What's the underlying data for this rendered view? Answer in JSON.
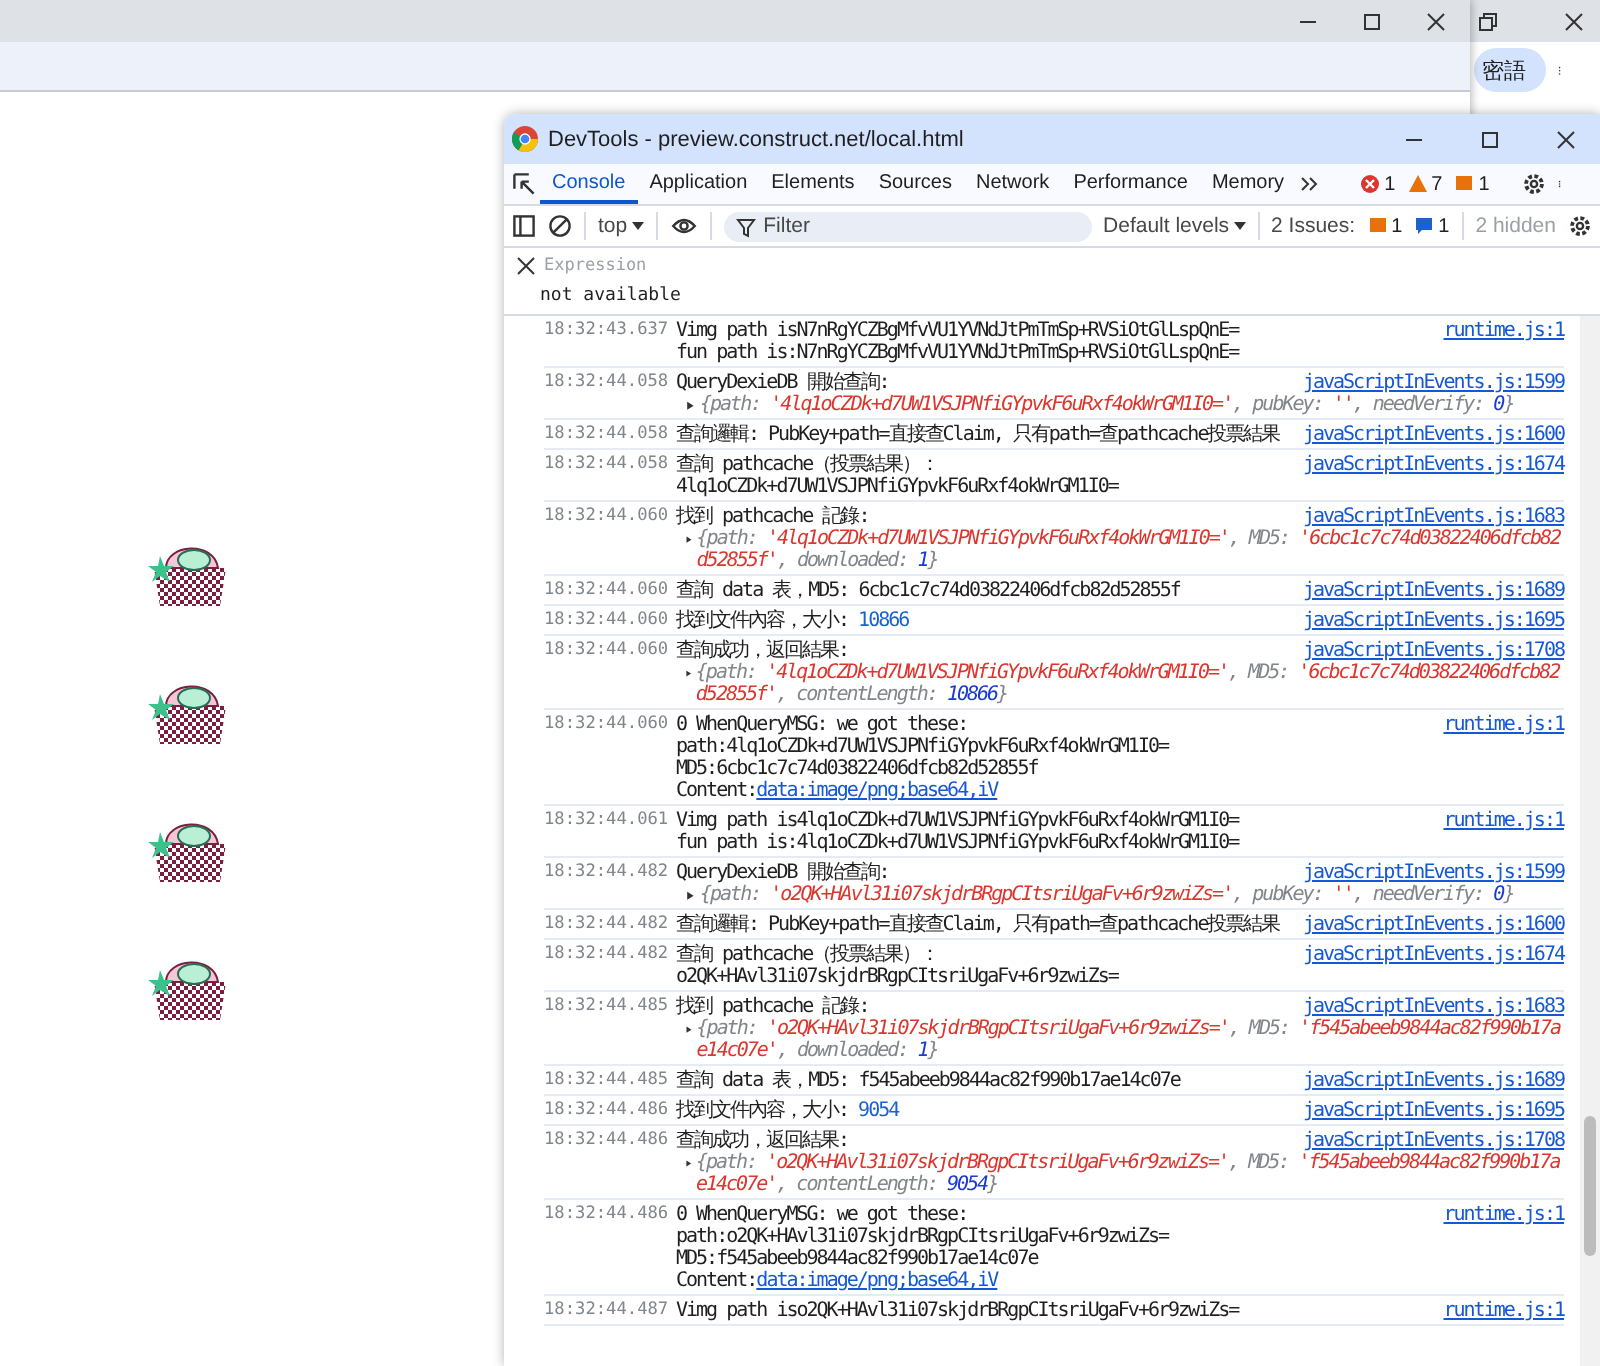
{
  "background_window": {
    "profile_button": "密語"
  },
  "devtools": {
    "title": "DevTools - preview.construct.net/local.html",
    "tabs": [
      {
        "label": "Console",
        "selected": true
      },
      {
        "label": "Application",
        "selected": false
      },
      {
        "label": "Elements",
        "selected": false
      },
      {
        "label": "Sources",
        "selected": false
      },
      {
        "label": "Network",
        "selected": false
      },
      {
        "label": "Performance",
        "selected": false
      },
      {
        "label": "Memory",
        "selected": false
      }
    ],
    "counters": {
      "errors": "1",
      "warnings": "7",
      "infos": "1"
    },
    "toolbar": {
      "context": "top",
      "filter_placeholder": "Filter",
      "levels": "Default levels",
      "issues_label": "2 Issues:",
      "issues_warning": "1",
      "issues_info": "1",
      "hidden": "2 hidden"
    },
    "expression": {
      "placeholder": "Expression",
      "value": "not available"
    },
    "logs": [
      {
        "time": "18:32:43.637",
        "source": "runtime.js:1",
        "lines": [
          {
            "kind": "text",
            "segments": [
              {
                "kind": "text",
                "text": "Vimg path isN7nRgYCZBgMfvVU1YVNdJtPmTmSp+RVSiOtGlLspQnE="
              }
            ]
          },
          {
            "kind": "text",
            "segments": [
              {
                "kind": "text",
                "text": "fun path is:N7nRgYCZBgMfvVU1YVNdJtPmTmSp+RVSiOtGlLspQnE="
              }
            ]
          }
        ]
      },
      {
        "time": "18:32:44.058",
        "source": "javaScriptInEvents.js:1599",
        "lines": [
          {
            "kind": "text",
            "segments": [
              {
                "kind": "text",
                "text": "QueryDexieDB 開始查詢:"
              }
            ]
          },
          {
            "kind": "object",
            "segments": [
              {
                "kind": "key",
                "text": "{path: "
              },
              {
                "kind": "string",
                "text": "'4lq1oCZDk+d7UW1VSJPNfiGYpvkF6uRxf4okWrGM1I0='"
              },
              {
                "kind": "key",
                "text": ", pubKey: "
              },
              {
                "kind": "string",
                "text": "''"
              },
              {
                "kind": "key",
                "text": ", needVerify: "
              },
              {
                "kind": "value",
                "text": "0"
              },
              {
                "kind": "key",
                "text": "}"
              }
            ]
          }
        ]
      },
      {
        "time": "18:32:44.058",
        "source": "javaScriptInEvents.js:1600",
        "lines": [
          {
            "kind": "text",
            "segments": [
              {
                "kind": "text",
                "text": "查詢邏輯: PubKey+path=直接查Claim, 只有path=查pathcache投票結果"
              }
            ]
          }
        ]
      },
      {
        "time": "18:32:44.058",
        "source": "javaScriptInEvents.js:1674",
        "lines": [
          {
            "kind": "text",
            "segments": [
              {
                "kind": "text",
                "text": "查詢 pathcache（投票結果）："
              }
            ]
          },
          {
            "kind": "text",
            "segments": [
              {
                "kind": "text",
                "text": "4lq1oCZDk+d7UW1VSJPNfiGYpvkF6uRxf4okWrGM1I0="
              }
            ]
          }
        ]
      },
      {
        "time": "18:32:44.060",
        "source": "javaScriptInEvents.js:1683",
        "lines": [
          {
            "kind": "text",
            "segments": [
              {
                "kind": "text",
                "text": "找到 pathcache 記錄:"
              }
            ]
          },
          {
            "kind": "object",
            "segments": [
              {
                "kind": "key",
                "text": "{path: "
              },
              {
                "kind": "string",
                "text": "'4lq1oCZDk+d7UW1VSJPNfiGYpvkF6uRxf4okWrGM1I0='"
              },
              {
                "kind": "key",
                "text": ", MD5: "
              },
              {
                "kind": "string",
                "text": "'6cbc1c7c74d03822406dfcb82d52855f'"
              },
              {
                "kind": "key",
                "text": ", downloaded: "
              },
              {
                "kind": "value",
                "text": "1"
              },
              {
                "kind": "key",
                "text": "}"
              }
            ]
          }
        ]
      },
      {
        "time": "18:32:44.060",
        "source": "javaScriptInEvents.js:1689",
        "lines": [
          {
            "kind": "text",
            "segments": [
              {
                "kind": "text",
                "text": "查詢 data 表，MD5: 6cbc1c7c74d03822406dfcb82d52855f"
              }
            ]
          }
        ]
      },
      {
        "time": "18:32:44.060",
        "source": "javaScriptInEvents.js:1695",
        "lines": [
          {
            "kind": "text",
            "segments": [
              {
                "kind": "text",
                "text": "找到文件內容，大小: "
              },
              {
                "kind": "number",
                "text": "10866"
              }
            ]
          }
        ]
      },
      {
        "time": "18:32:44.060",
        "source": "javaScriptInEvents.js:1708",
        "lines": [
          {
            "kind": "text",
            "segments": [
              {
                "kind": "text",
                "text": "查詢成功，返回結果:"
              }
            ]
          },
          {
            "kind": "object",
            "segments": [
              {
                "kind": "key",
                "text": "{path: "
              },
              {
                "kind": "string",
                "text": "'4lq1oCZDk+d7UW1VSJPNfiGYpvkF6uRxf4okWrGM1I0='"
              },
              {
                "kind": "key",
                "text": ", MD5: "
              },
              {
                "kind": "string",
                "text": "'6cbc1c7c74d03822406dfcb82d52855f'"
              },
              {
                "kind": "key",
                "text": ", contentLength: "
              },
              {
                "kind": "value",
                "text": "10866"
              },
              {
                "kind": "key",
                "text": "}"
              }
            ]
          }
        ]
      },
      {
        "time": "18:32:44.060",
        "source": "runtime.js:1",
        "lines": [
          {
            "kind": "text",
            "segments": [
              {
                "kind": "text",
                "text": "0 WhenQueryMSG: we got these:"
              }
            ]
          },
          {
            "kind": "text",
            "segments": [
              {
                "kind": "text",
                "text": "path:4lq1oCZDk+d7UW1VSJPNfiGYpvkF6uRxf4okWrGM1I0="
              }
            ]
          },
          {
            "kind": "text",
            "segments": [
              {
                "kind": "text",
                "text": "MD5:6cbc1c7c74d03822406dfcb82d52855f"
              }
            ]
          },
          {
            "kind": "text",
            "segments": [
              {
                "kind": "text",
                "text": "Content:"
              },
              {
                "kind": "link",
                "text": "data:image/png;base64,iV"
              }
            ]
          }
        ]
      },
      {
        "time": "18:32:44.061",
        "source": "runtime.js:1",
        "lines": [
          {
            "kind": "text",
            "segments": [
              {
                "kind": "text",
                "text": "Vimg path is4lq1oCZDk+d7UW1VSJPNfiGYpvkF6uRxf4okWrGM1I0="
              }
            ]
          },
          {
            "kind": "text",
            "segments": [
              {
                "kind": "text",
                "text": "fun path is:4lq1oCZDk+d7UW1VSJPNfiGYpvkF6uRxf4okWrGM1I0="
              }
            ]
          }
        ]
      },
      {
        "time": "18:32:44.482",
        "source": "javaScriptInEvents.js:1599",
        "lines": [
          {
            "kind": "text",
            "segments": [
              {
                "kind": "text",
                "text": "QueryDexieDB 開始查詢:"
              }
            ]
          },
          {
            "kind": "object",
            "segments": [
              {
                "kind": "key",
                "text": "{path: "
              },
              {
                "kind": "string",
                "text": "'o2QK+HAvl31i07skjdrBRgpCItsriUgaFv+6r9zwiZs='"
              },
              {
                "kind": "key",
                "text": ", pubKey: "
              },
              {
                "kind": "string",
                "text": "''"
              },
              {
                "kind": "key",
                "text": ", needVerify: "
              },
              {
                "kind": "value",
                "text": "0"
              },
              {
                "kind": "key",
                "text": "}"
              }
            ]
          }
        ]
      },
      {
        "time": "18:32:44.482",
        "source": "javaScriptInEvents.js:1600",
        "lines": [
          {
            "kind": "text",
            "segments": [
              {
                "kind": "text",
                "text": "查詢邏輯: PubKey+path=直接查Claim, 只有path=查pathcache投票結果"
              }
            ]
          }
        ]
      },
      {
        "time": "18:32:44.482",
        "source": "javaScriptInEvents.js:1674",
        "lines": [
          {
            "kind": "text",
            "segments": [
              {
                "kind": "text",
                "text": "查詢 pathcache（投票結果）："
              }
            ]
          },
          {
            "kind": "text",
            "segments": [
              {
                "kind": "text",
                "text": "o2QK+HAvl31i07skjdrBRgpCItsriUgaFv+6r9zwiZs="
              }
            ]
          }
        ]
      },
      {
        "time": "18:32:44.485",
        "source": "javaScriptInEvents.js:1683",
        "lines": [
          {
            "kind": "text",
            "segments": [
              {
                "kind": "text",
                "text": "找到 pathcache 記錄:"
              }
            ]
          },
          {
            "kind": "object",
            "segments": [
              {
                "kind": "key",
                "text": "{path: "
              },
              {
                "kind": "string",
                "text": "'o2QK+HAvl31i07skjdrBRgpCItsriUgaFv+6r9zwiZs='"
              },
              {
                "kind": "key",
                "text": ", MD5: "
              },
              {
                "kind": "string",
                "text": "'f545abeeb9844ac82f990b17ae14c07e'"
              },
              {
                "kind": "key",
                "text": ", downloaded: "
              },
              {
                "kind": "value",
                "text": "1"
              },
              {
                "kind": "key",
                "text": "}"
              }
            ]
          }
        ]
      },
      {
        "time": "18:32:44.485",
        "source": "javaScriptInEvents.js:1689",
        "lines": [
          {
            "kind": "text",
            "segments": [
              {
                "kind": "text",
                "text": "查詢 data 表，MD5: f545abeeb9844ac82f990b17ae14c07e"
              }
            ]
          }
        ]
      },
      {
        "time": "18:32:44.486",
        "source": "javaScriptInEvents.js:1695",
        "lines": [
          {
            "kind": "text",
            "segments": [
              {
                "kind": "text",
                "text": "找到文件內容，大小: "
              },
              {
                "kind": "number",
                "text": "9054"
              }
            ]
          }
        ]
      },
      {
        "time": "18:32:44.486",
        "source": "javaScriptInEvents.js:1708",
        "lines": [
          {
            "kind": "text",
            "segments": [
              {
                "kind": "text",
                "text": "查詢成功，返回結果:"
              }
            ]
          },
          {
            "kind": "object",
            "segments": [
              {
                "kind": "key",
                "text": "{path: "
              },
              {
                "kind": "string",
                "text": "'o2QK+HAvl31i07skjdrBRgpCItsriUgaFv+6r9zwiZs='"
              },
              {
                "kind": "key",
                "text": ", MD5: "
              },
              {
                "kind": "string",
                "text": "'f545abeeb9844ac82f990b17ae14c07e'"
              },
              {
                "kind": "key",
                "text": ", contentLength: "
              },
              {
                "kind": "value",
                "text": "9054"
              },
              {
                "kind": "key",
                "text": "}"
              }
            ]
          }
        ]
      },
      {
        "time": "18:32:44.486",
        "source": "runtime.js:1",
        "lines": [
          {
            "kind": "text",
            "segments": [
              {
                "kind": "text",
                "text": "0 WhenQueryMSG: we got these:"
              }
            ]
          },
          {
            "kind": "text",
            "segments": [
              {
                "kind": "text",
                "text": "path:o2QK+HAvl31i07skjdrBRgpCItsriUgaFv+6r9zwiZs="
              }
            ]
          },
          {
            "kind": "text",
            "segments": [
              {
                "kind": "text",
                "text": "MD5:f545abeeb9844ac82f990b17ae14c07e"
              }
            ]
          },
          {
            "kind": "text",
            "segments": [
              {
                "kind": "text",
                "text": "Content:"
              },
              {
                "kind": "link",
                "text": "data:image/png;base64,iV"
              }
            ]
          }
        ]
      },
      {
        "time": "18:32:44.487",
        "source": "runtime.js:1",
        "lines": [
          {
            "kind": "text",
            "segments": [
              {
                "kind": "text",
                "text": "Vimg path iso2QK+HAvl31i07skjdrBRgpCItsriUgaFv+6r9zwiZs="
              }
            ]
          }
        ]
      }
    ]
  }
}
